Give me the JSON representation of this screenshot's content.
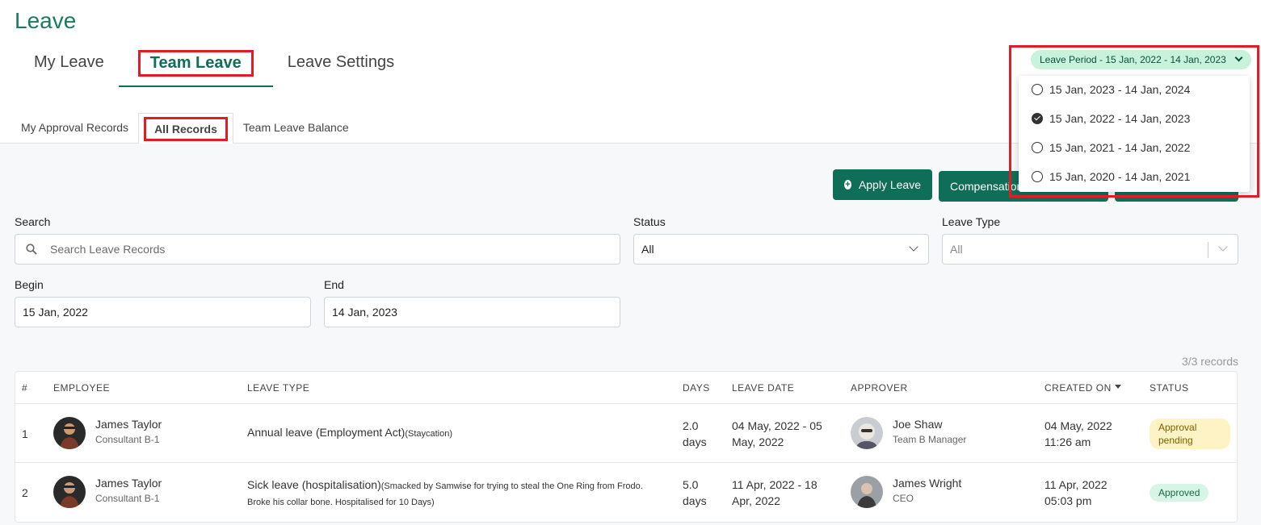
{
  "page": {
    "title": "Leave"
  },
  "main_tabs": [
    {
      "label": "My Leave"
    },
    {
      "label": "Team Leave"
    },
    {
      "label": "Leave Settings"
    }
  ],
  "sub_tabs": [
    {
      "label": "My Approval Records"
    },
    {
      "label": "All Records"
    },
    {
      "label": "Team Leave Balance"
    }
  ],
  "actions": {
    "apply_leave": "Apply Leave",
    "compensation": "Compensation"
  },
  "filters": {
    "search": {
      "label": "Search",
      "placeholder": "Search Leave Records"
    },
    "status": {
      "label": "Status",
      "value": "All"
    },
    "leave_type": {
      "label": "Leave Type",
      "value": "All"
    },
    "begin": {
      "label": "Begin",
      "value": "15 Jan, 2022"
    },
    "end": {
      "label": "End",
      "value": "14 Jan, 2023"
    }
  },
  "records_count": "3/3 records",
  "table": {
    "headers": {
      "num": "#",
      "employee": "EMPLOYEE",
      "leave_type": "LEAVE TYPE",
      "days": "DAYS",
      "leave_date": "LEAVE DATE",
      "approver": "APPROVER",
      "created_on": "CREATED ON",
      "status": "STATUS"
    },
    "rows": [
      {
        "num": "1",
        "employee_name": "James Taylor",
        "employee_title": "Consultant B-1",
        "leave_type": "Annual leave (Employment Act)",
        "leave_note": "(Staycation)",
        "leave_note_2": "",
        "days_1": "2.0",
        "days_2": "days",
        "date_1": "04 May, 2022 - 05",
        "date_2": "May, 2022",
        "approver_name": "Joe Shaw",
        "approver_title": "Team B Manager",
        "created_1": "04 May, 2022",
        "created_2": "11:26 am",
        "status": "Approval pending"
      },
      {
        "num": "2",
        "employee_name": "James Taylor",
        "employee_title": "Consultant B-1",
        "leave_type": "Sick leave (hospitalisation)",
        "leave_note": "(Smacked by Samwise for trying to steal the One Ring from Frodo.",
        "leave_note_2": "Broke his collar bone. Hospitalised for 10 Days)",
        "days_1": "5.0",
        "days_2": "days",
        "date_1": "11 Apr, 2022 - 18",
        "date_2": "Apr, 2022",
        "approver_name": "James Wright",
        "approver_title": "CEO",
        "created_1": "11 Apr, 2022",
        "created_2": "05:03 pm",
        "status": "Approved"
      }
    ]
  },
  "leave_period": {
    "label": "Leave Period - 15 Jan, 2022 - 14 Jan, 2023",
    "options": [
      {
        "label": "15 Jan, 2023 - 14 Jan, 2024",
        "selected": false
      },
      {
        "label": "15 Jan, 2022 - 14 Jan, 2023",
        "selected": true
      },
      {
        "label": "15 Jan, 2021 - 14 Jan, 2022",
        "selected": false
      },
      {
        "label": "15 Jan, 2020 - 14 Jan, 2021",
        "selected": false
      }
    ]
  },
  "colors": {
    "brand": "#0f6e57",
    "highlight": "#e31b23",
    "pending_bg": "#fdf3c4",
    "approved_bg": "#d6f5e6"
  }
}
